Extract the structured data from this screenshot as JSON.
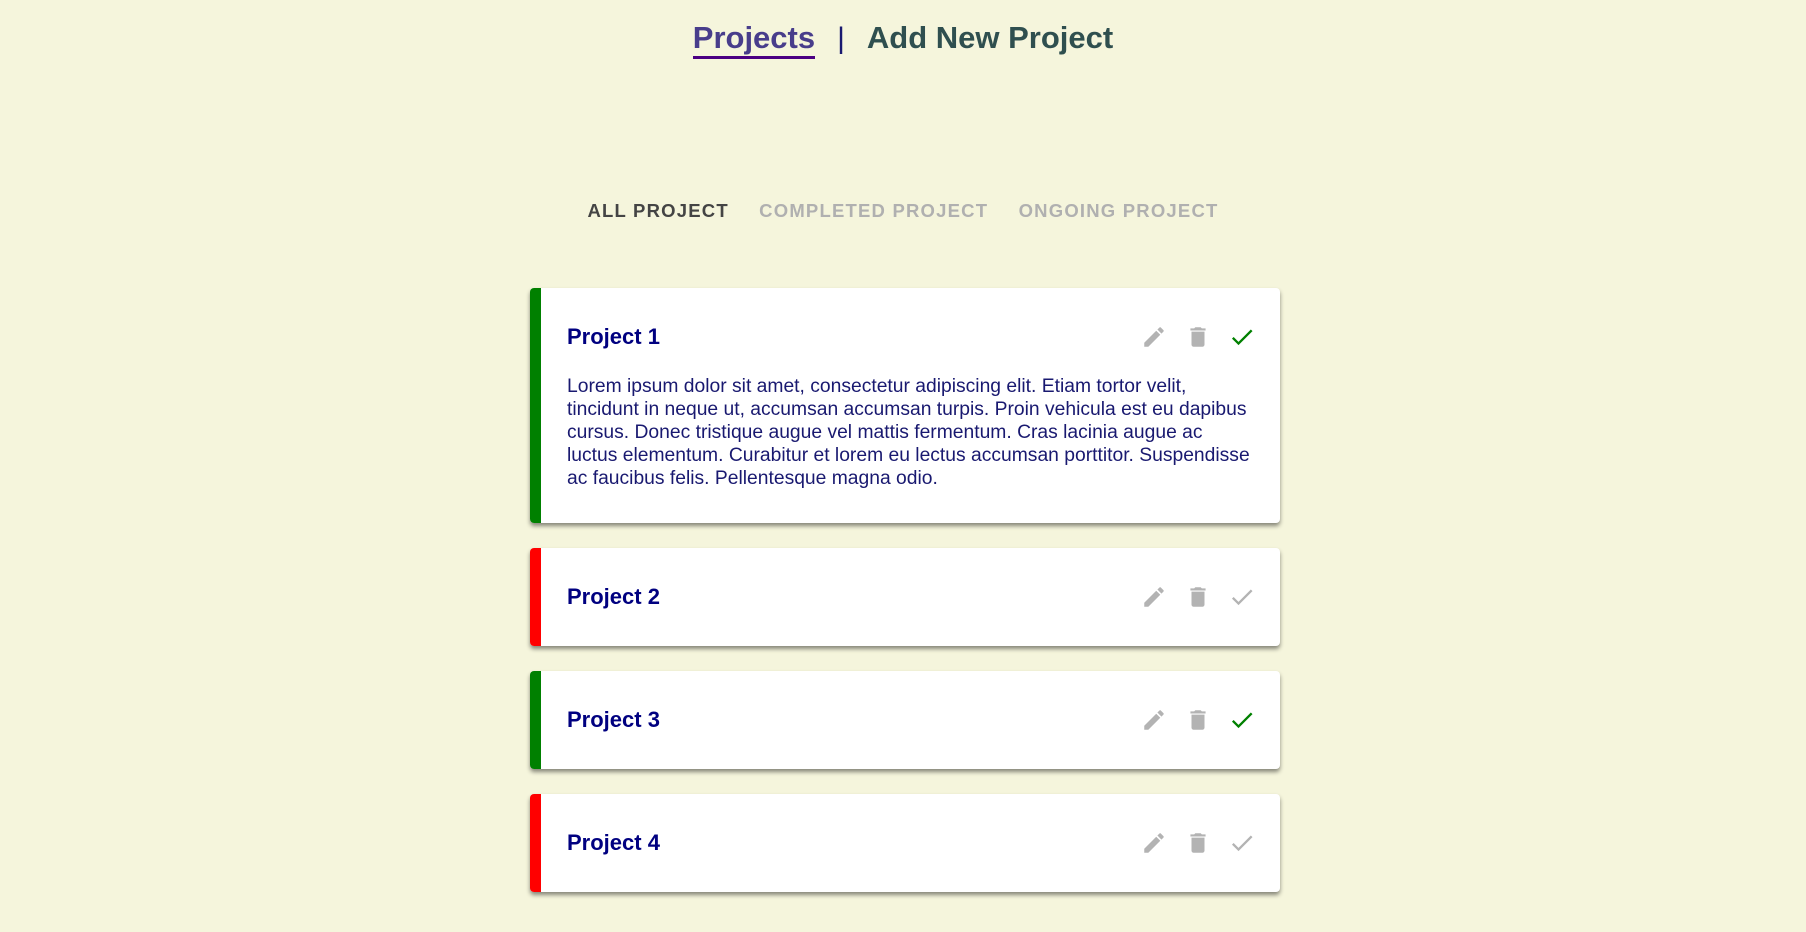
{
  "nav": {
    "projects_label": "Projects",
    "separator": "|",
    "add_label": "Add New Project"
  },
  "filters": {
    "all": "ALL PROJECT",
    "completed": "COMPLETED PROJECT",
    "ongoing": "ONGOING PROJECT",
    "active": "all"
  },
  "colors": {
    "completed": "#008000",
    "ongoing": "#ff0000",
    "icon_grey": "#b3b3b3"
  },
  "projects": [
    {
      "title": "Project 1",
      "status": "completed",
      "description": "Lorem ipsum dolor sit amet, consectetur adipiscing elit. Etiam tortor velit, tincidunt in neque ut, accumsan accumsan turpis. Proin vehicula est eu dapibus cursus. Donec tristique augue vel mattis fermentum. Cras lacinia augue ac luctus elementum. Curabitur et lorem eu lectus accumsan porttitor. Suspendisse ac faucibus felis. Pellentesque magna odio.",
      "icons": [
        "pencil-icon",
        "trash-icon",
        "check-icon"
      ]
    },
    {
      "title": "Project 2",
      "status": "ongoing",
      "description": "",
      "icons": [
        "pencil-icon",
        "trash-icon",
        "check-icon"
      ]
    },
    {
      "title": "Project 3",
      "status": "completed",
      "description": "",
      "icons": [
        "pencil-icon",
        "trash-icon",
        "check-icon"
      ]
    },
    {
      "title": "Project 4",
      "status": "ongoing",
      "description": "",
      "icons": [
        "pencil-icon",
        "trash-icon",
        "check-icon"
      ]
    }
  ]
}
